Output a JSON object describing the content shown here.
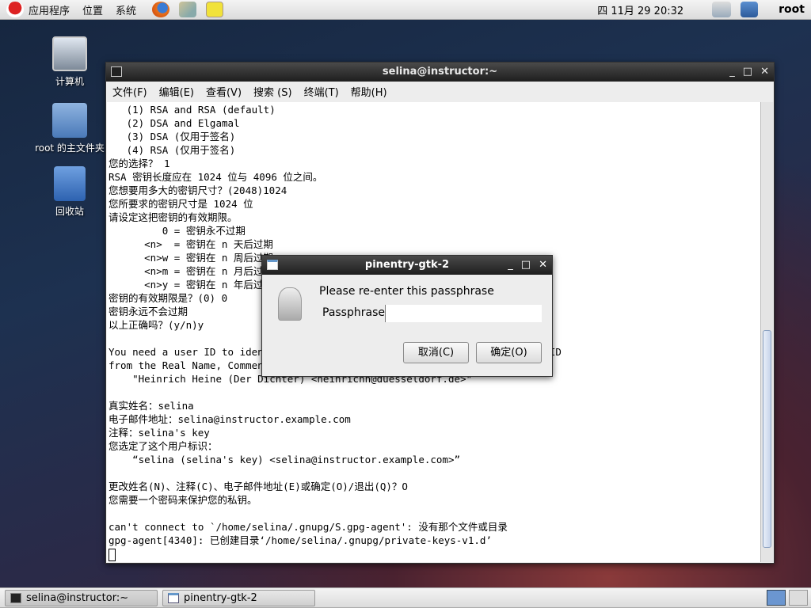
{
  "top_panel": {
    "menus": [
      "应用程序",
      "位置",
      "系统"
    ],
    "clock": "四 11月 29 20:32",
    "user": "root"
  },
  "desktop": {
    "icons": [
      "计算机",
      "root 的主文件夹",
      "回收站"
    ]
  },
  "terminal": {
    "title": "selina@instructor:~",
    "menu": [
      "文件(F)",
      "编辑(E)",
      "查看(V)",
      "搜索 (S)",
      "终端(T)",
      "帮助(H)"
    ],
    "lines": [
      "   (1) RSA and RSA (default)",
      "   (2) DSA and Elgamal",
      "   (3) DSA (仅用于签名)",
      "   (4) RSA (仅用于签名)",
      "您的选择？ 1",
      "RSA 密钥长度应在 1024 位与 4096 位之间。",
      "您想要用多大的密钥尺寸？(2048)1024",
      "您所要求的密钥尺寸是 1024 位",
      "请设定这把密钥的有效期限。",
      "         0 = 密钥永不过期",
      "      <n>  = 密钥在 n 天后过期",
      "      <n>w = 密钥在 n 周后过期",
      "      <n>m = 密钥在 n 月后过期",
      "      <n>y = 密钥在 n 年后过期",
      "密钥的有效期限是？(0) 0",
      "密钥永远不会过期",
      "以上正确吗？(y/n)y",
      "",
      "You need a user ID to identify your key; the software constructs the user ID",
      "from the Real Name, Comment and Email Address in this form:",
      "    \"Heinrich Heine (Der Dichter) <heinrichh@duesseldorf.de>\"",
      "",
      "真实姓名：selina",
      "电子邮件地址：selina@instructor.example.com",
      "注释：selina's key",
      "您选定了这个用户标识：",
      "    “selina (selina's key) <selina@instructor.example.com>”",
      "",
      "更改姓名(N)、注释(C)、电子邮件地址(E)或确定(O)/退出(Q)？O",
      "您需要一个密码来保护您的私钥。",
      "",
      "can't connect to `/home/selina/.gnupg/S.gpg-agent': 没有那个文件或目录",
      "gpg-agent[4340]: 已创建目录‘/home/selina/.gnupg/private-keys-v1.d’"
    ]
  },
  "dialog": {
    "title": "pinentry-gtk-2",
    "prompt": "Please re-enter this passphrase",
    "label": "Passphrase",
    "value": "",
    "cancel": "取消(C)",
    "ok": "确定(O)"
  },
  "taskbar": {
    "items": [
      "selina@instructor:~",
      "pinentry-gtk-2"
    ]
  }
}
